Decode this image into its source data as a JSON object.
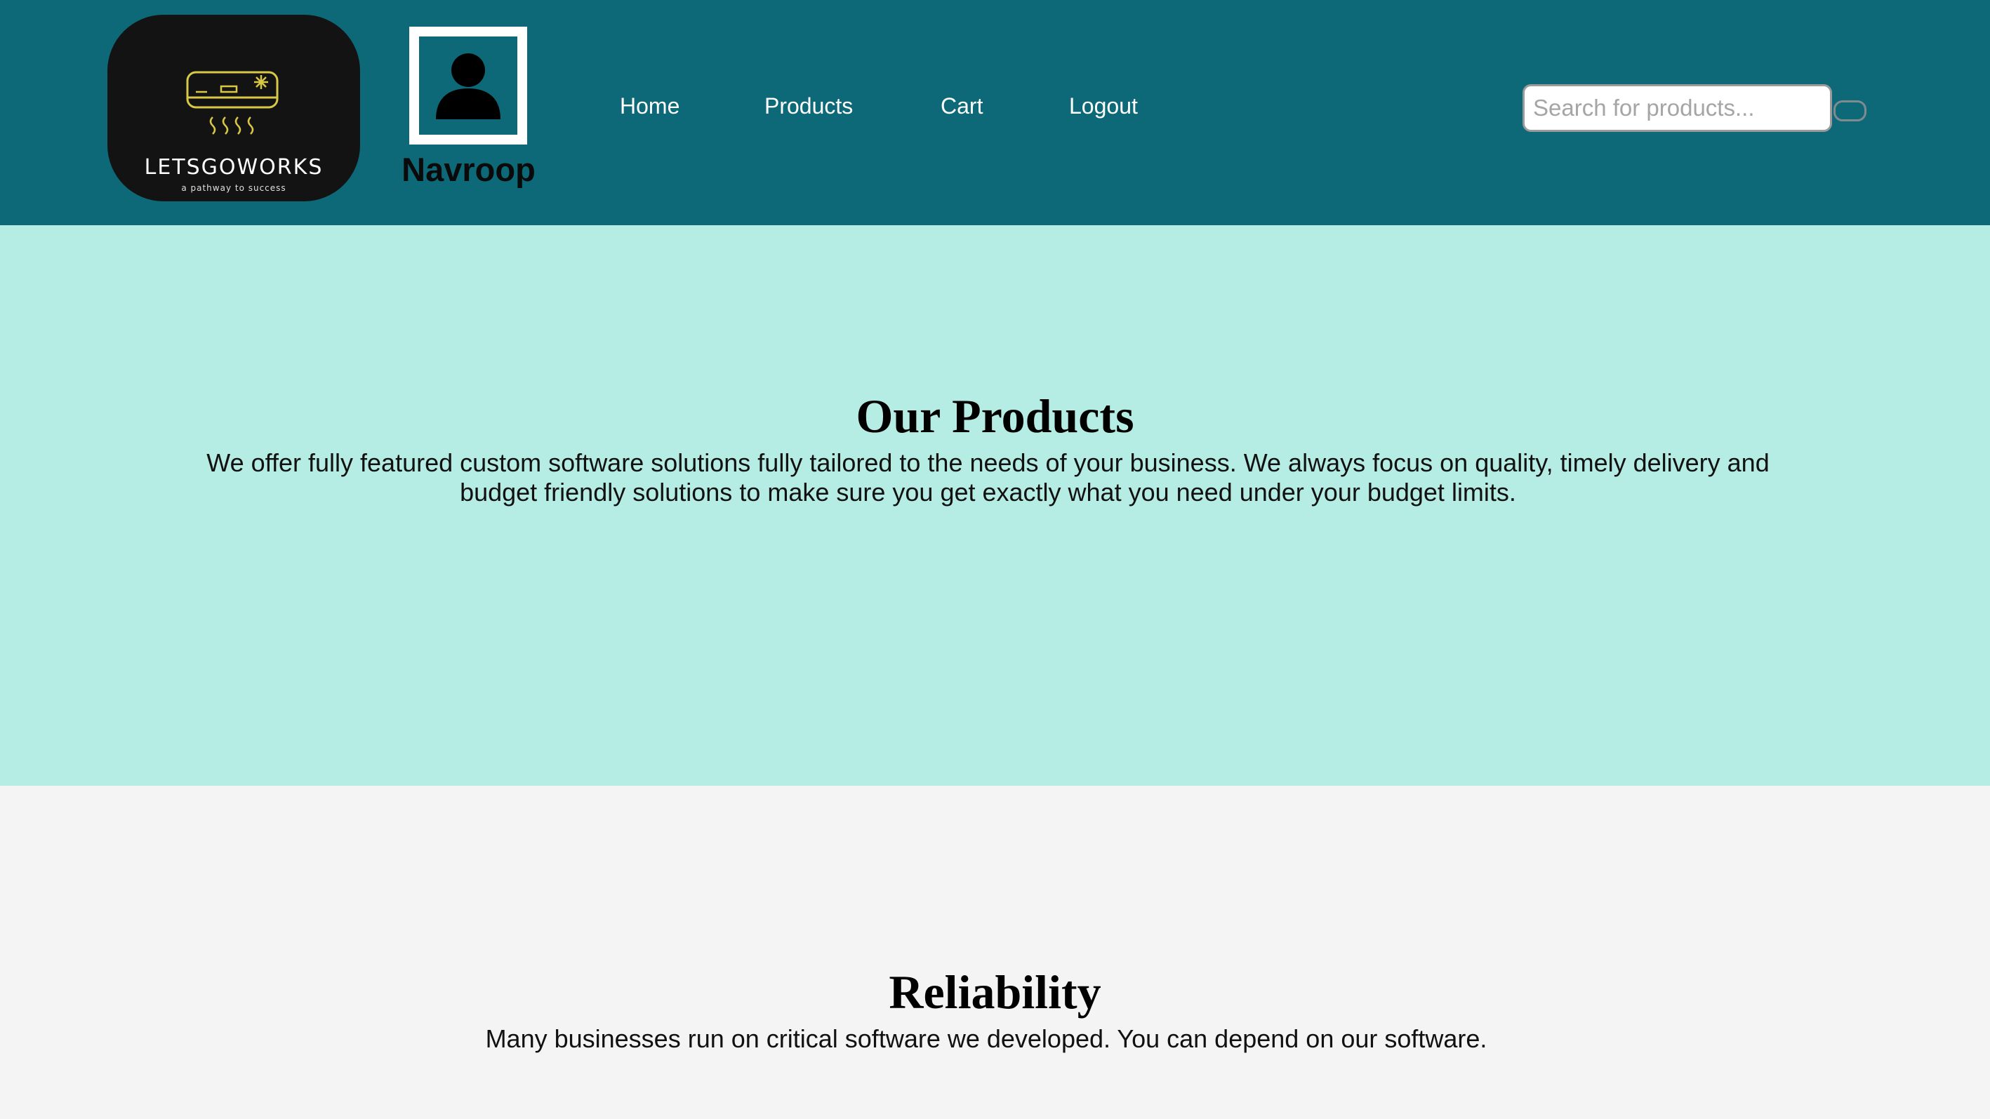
{
  "brand": {
    "name": "LETSGOWORKS",
    "tagline": "a pathway to success",
    "accent_color": "#d9c846",
    "icon": "air-conditioner-icon"
  },
  "user": {
    "name": "Navroop",
    "icon": "user-silhouette-icon"
  },
  "nav": {
    "home": "Home",
    "products": "Products",
    "cart": "Cart",
    "logout": "Logout"
  },
  "search": {
    "placeholder": "Search for products...",
    "value": ""
  },
  "sections": {
    "products": {
      "title": "Our Products",
      "text": "We offer fully featured custom software solutions fully tailored to the needs of your business. We always focus on quality, timely delivery and budget friendly solutions to make sure you get exactly what you need under your budget limits."
    },
    "reliability": {
      "title": "Reliability",
      "text": "Many businesses run on critical software we developed. You can depend on our software."
    }
  },
  "colors": {
    "header_bg": "#0d6978",
    "products_bg": "#b5ece3",
    "page_bg": "#f4f4f4"
  }
}
